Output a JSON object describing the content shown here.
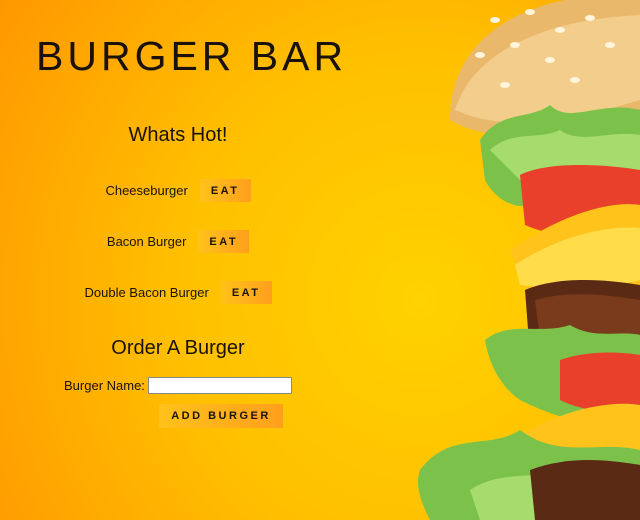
{
  "header": {
    "title": "BURGER BAR"
  },
  "hot_section": {
    "title": "Whats Hot!",
    "items": [
      {
        "name": "Cheeseburger",
        "button_label": "EAT"
      },
      {
        "name": "Bacon Burger",
        "button_label": "EAT"
      },
      {
        "name": "Double Bacon Burger",
        "button_label": "EAT"
      }
    ]
  },
  "order_section": {
    "title": "Order A Burger",
    "field_label": "Burger Name:",
    "field_value": "",
    "submit_label": "ADD BURGER"
  },
  "colors": {
    "background_center": "#ffd200",
    "background_edge": "#ff8a00",
    "button": "#ffb21c",
    "text": "#1a1208"
  }
}
